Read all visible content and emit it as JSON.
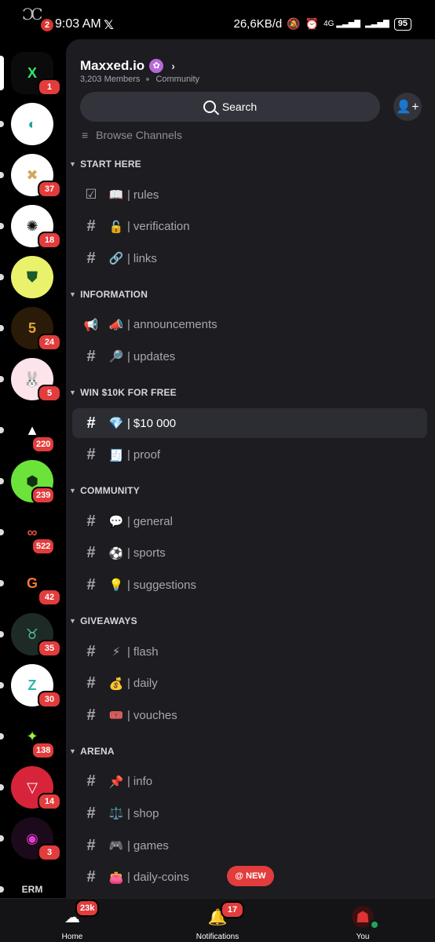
{
  "status_bar": {
    "logo_text": "ƆC",
    "notification_count": "2",
    "time": "9:03 AM",
    "x_icon": "𝕏",
    "network_speed": "26,6KB/d",
    "battery": "95",
    "network_type": "4G"
  },
  "server_rail": [
    {
      "name": "Maxxed.io",
      "badge": "1",
      "selected": true,
      "bg": "#0b0b0b",
      "fg": "#2ee86a",
      "glyph": "X"
    },
    {
      "name": "server-2",
      "badge": "",
      "bg": "#ffffff",
      "fg": "#1aa3a3",
      "glyph": "◐"
    },
    {
      "name": "server-3",
      "badge": "37",
      "bg": "#ffffff",
      "fg": "#d6a65a",
      "glyph": "✖"
    },
    {
      "name": "server-4",
      "badge": "18",
      "bg": "#ffffff",
      "fg": "#111111",
      "glyph": "✺"
    },
    {
      "name": "server-5",
      "badge": "",
      "bg": "#e9f26a",
      "fg": "#1d5a2d",
      "glyph": "⛊"
    },
    {
      "name": "server-6",
      "badge": "24",
      "bg": "#2a1a08",
      "fg": "#e8a33a",
      "glyph": "5"
    },
    {
      "name": "server-7",
      "badge": "5",
      "bg": "#fde3ea",
      "fg": "#333333",
      "glyph": "🐰"
    },
    {
      "name": "server-8",
      "badge": "220",
      "bg": "#000000",
      "fg": "#ffffff",
      "glyph": "▲"
    },
    {
      "name": "server-9",
      "badge": "239",
      "bg": "#6be33b",
      "fg": "#103010",
      "glyph": "⬢"
    },
    {
      "name": "server-10",
      "badge": "522",
      "bg": "#000000",
      "fg": "#e0513a",
      "glyph": "∞"
    },
    {
      "name": "server-11",
      "badge": "42",
      "bg": "#000000",
      "fg": "#f07a2a",
      "glyph": "G"
    },
    {
      "name": "server-12",
      "badge": "35",
      "bg": "#1e2a26",
      "fg": "#4fc08d",
      "glyph": "♉"
    },
    {
      "name": "server-13",
      "badge": "30",
      "bg": "#ffffff",
      "fg": "#2bb8a8",
      "glyph": "Z"
    },
    {
      "name": "server-14",
      "badge": "138",
      "bg": "#000000",
      "fg": "#9ef03b",
      "glyph": "✦"
    },
    {
      "name": "server-15",
      "badge": "14",
      "bg": "#d8243a",
      "fg": "#ffffff",
      "glyph": "▽"
    },
    {
      "name": "server-16",
      "badge": "3",
      "bg": "#1a0a1a",
      "fg": "#e33ccf",
      "glyph": "◉"
    },
    {
      "name": "server-17",
      "badge": "",
      "bg": "#000000",
      "fg": "#dddddd",
      "glyph": "ERM"
    }
  ],
  "server": {
    "name": "Maxxed.io",
    "members": "3,203 Members",
    "type": "Community"
  },
  "search": {
    "label": "Search"
  },
  "browse_channels": "Browse Channels",
  "categories": [
    {
      "name": "START HERE",
      "channels": [
        {
          "kind": "rules",
          "emoji": "📖",
          "name": "rules"
        },
        {
          "kind": "locked",
          "emoji": "🔓",
          "name": "verification"
        },
        {
          "kind": "locked",
          "emoji": "🔗",
          "name": "links"
        }
      ]
    },
    {
      "name": "INFORMATION",
      "channels": [
        {
          "kind": "announce",
          "emoji": "📣",
          "name": "announcements"
        },
        {
          "kind": "locked",
          "emoji": "🔎",
          "name": "updates"
        }
      ]
    },
    {
      "name": "WIN $10K FOR FREE",
      "channels": [
        {
          "kind": "text",
          "emoji": "💎",
          "name": "$10 000",
          "selected": true
        },
        {
          "kind": "text",
          "emoji": "🧾",
          "name": "proof"
        }
      ]
    },
    {
      "name": "COMMUNITY",
      "channels": [
        {
          "kind": "locked",
          "emoji": "💬",
          "name": "general"
        },
        {
          "kind": "locked",
          "emoji": "⚽",
          "name": "sports"
        },
        {
          "kind": "locked",
          "emoji": "💡",
          "name": "suggestions"
        }
      ]
    },
    {
      "name": "GIVEAWAYS",
      "channels": [
        {
          "kind": "locked",
          "emoji": "⚡",
          "name": "flash"
        },
        {
          "kind": "locked",
          "emoji": "💰",
          "name": "daily"
        },
        {
          "kind": "locked",
          "emoji": "🎟️",
          "name": "vouches"
        }
      ]
    },
    {
      "name": "ARENA",
      "channels": [
        {
          "kind": "locked",
          "emoji": "📌",
          "name": "info"
        },
        {
          "kind": "locked",
          "emoji": "⚖️",
          "name": "shop"
        },
        {
          "kind": "locked",
          "emoji": "🎮",
          "name": "games"
        },
        {
          "kind": "locked",
          "emoji": "👛",
          "name": "daily-coins"
        }
      ]
    }
  ],
  "new_pill": {
    "label": "NEW"
  },
  "bottom_nav": {
    "home": {
      "label": "Home",
      "badge": "23k"
    },
    "notifications": {
      "label": "Notifications",
      "badge": "17"
    },
    "you": {
      "label": "You"
    }
  }
}
